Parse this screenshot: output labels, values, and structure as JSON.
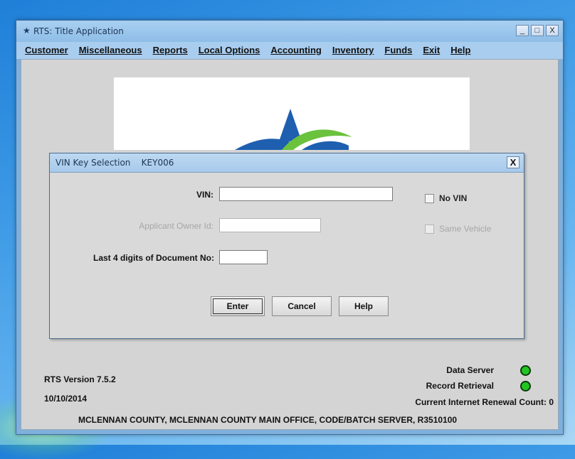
{
  "window": {
    "title": "RTS: Title Application",
    "icon": "star-icon",
    "controls": {
      "minimize": "_",
      "maximize": "□",
      "close": "X"
    }
  },
  "menubar": [
    {
      "label": "Customer"
    },
    {
      "label": "Miscellaneous"
    },
    {
      "label": "Reports"
    },
    {
      "label": "Local Options"
    },
    {
      "label": "Accounting"
    },
    {
      "label": "Inventory"
    },
    {
      "label": "Funds"
    },
    {
      "label": "Exit"
    },
    {
      "label": "Help"
    }
  ],
  "dialog": {
    "title": "VIN Key Selection    KEY006",
    "close": "X",
    "fields": {
      "vin": {
        "label": "VIN:",
        "value": ""
      },
      "owner_id": {
        "label": "Applicant Owner Id:",
        "value": ""
      },
      "doc_no": {
        "label": "Last 4 digits of Document No:",
        "value": ""
      }
    },
    "checkboxes": {
      "no_vin": {
        "label": "No VIN",
        "checked": false
      },
      "same_vehicle": {
        "label": "Same Vehicle",
        "checked": false
      }
    },
    "buttons": {
      "enter": "Enter",
      "cancel": "Cancel",
      "help": "Help"
    }
  },
  "footer": {
    "version": "RTS Version 7.5.2",
    "date": "10/10/2014",
    "data_server": "Data Server",
    "record_retrieval": "Record Retrieval",
    "renewal_count": "Current Internet Renewal Count: 0",
    "office": "MCLENNAN COUNTY, MCLENNAN COUNTY MAIN OFFICE, CODE/BATCH SERVER, R3510100"
  },
  "colors": {
    "status_led": "#22c522",
    "logo_blue": "#1e5fb0",
    "logo_green": "#6ac23d"
  }
}
